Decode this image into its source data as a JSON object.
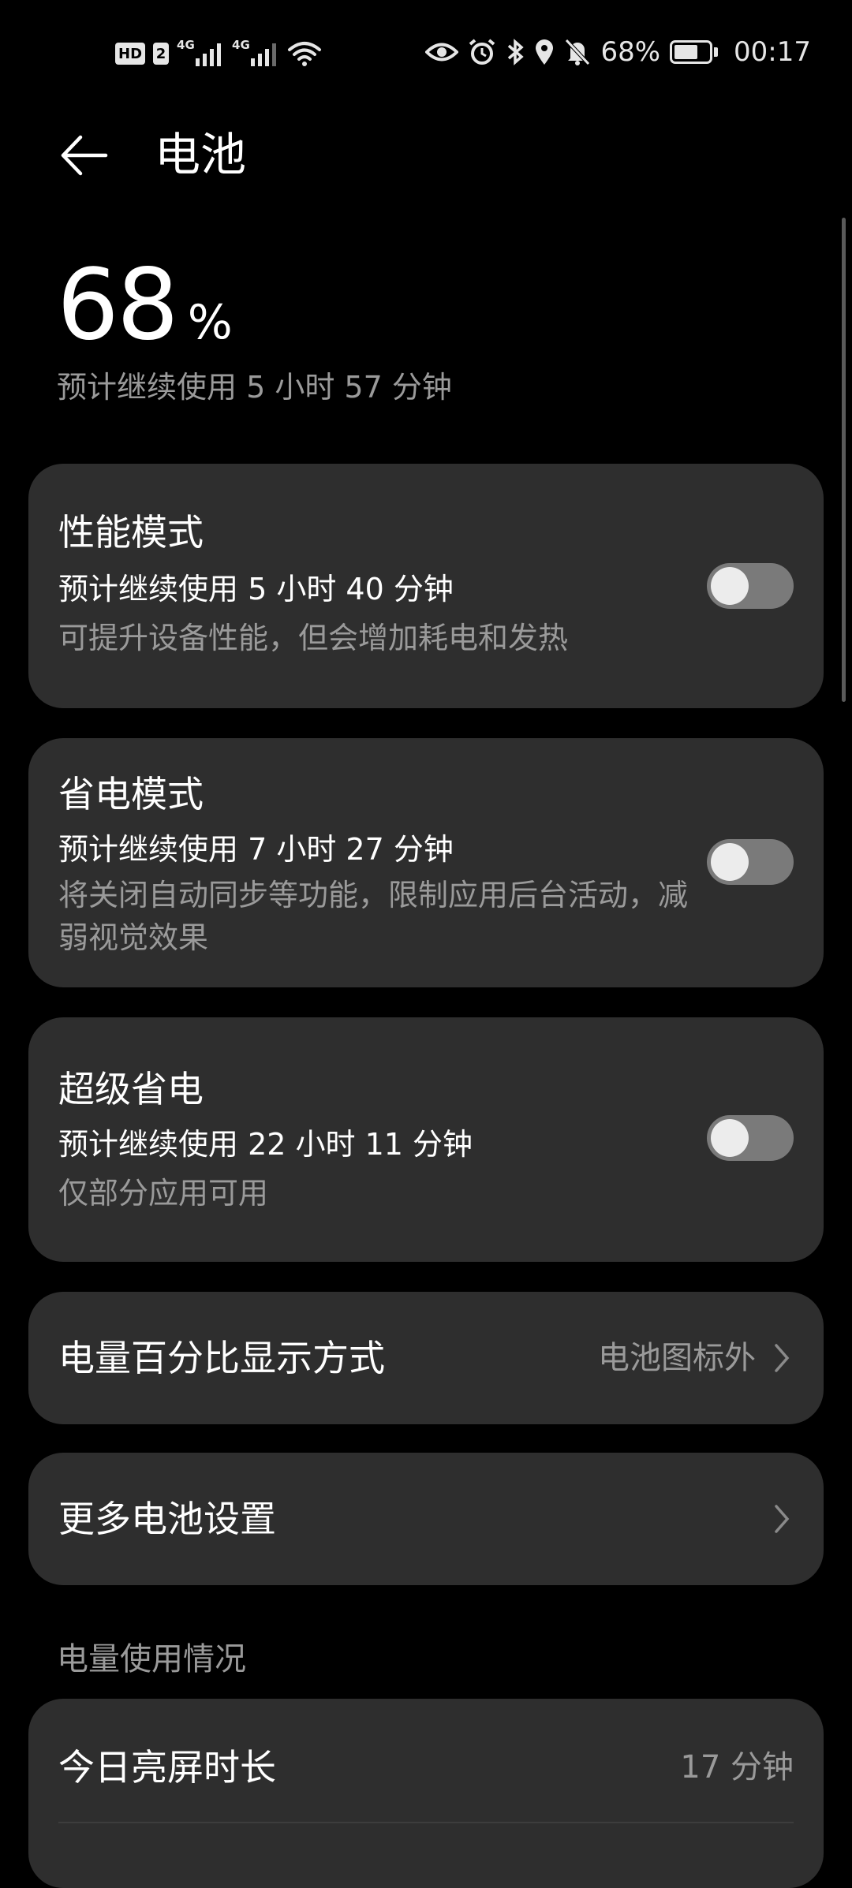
{
  "status_bar": {
    "hd_label": "HD",
    "sim_label": "2",
    "network_1": "4G",
    "network_2": "4G",
    "battery_pct": "68%",
    "battery_level": 0.68,
    "time": "00:17",
    "icons": [
      "signal-icon",
      "wifi-icon",
      "eye-icon",
      "alarm-icon",
      "bluetooth-icon",
      "location-icon",
      "mute-icon",
      "battery-icon"
    ]
  },
  "header": {
    "title": "电池",
    "back_icon": "arrow-left-icon"
  },
  "summary": {
    "percent": "68",
    "unit": "%",
    "estimate": "预计继续使用 5 小时 57 分钟"
  },
  "modes": [
    {
      "title": "性能模式",
      "estimate": "预计继续使用 5 小时 40 分钟",
      "desc": "可提升设备性能，但会增加耗电和发热",
      "enabled": false
    },
    {
      "title": "省电模式",
      "estimate": "预计继续使用 7 小时 27 分钟",
      "desc": "将关闭自动同步等功能，限制应用后台活动，减弱视觉效果",
      "enabled": false
    },
    {
      "title": "超级省电",
      "estimate": "预计继续使用 22 小时 11 分钟",
      "desc": "仅部分应用可用",
      "enabled": false
    }
  ],
  "display_setting": {
    "label": "电量百分比显示方式",
    "value": "电池图标外"
  },
  "more_settings": {
    "label": "更多电池设置"
  },
  "usage": {
    "section_title": "电量使用情况",
    "screen_on_label": "今日亮屏时长",
    "screen_on_value": "17 分钟"
  },
  "colors": {
    "background": "#000000",
    "card": "#2e2e2e",
    "secondary_text": "#9a9a9a",
    "toggle_off": "#7a7a7a"
  }
}
